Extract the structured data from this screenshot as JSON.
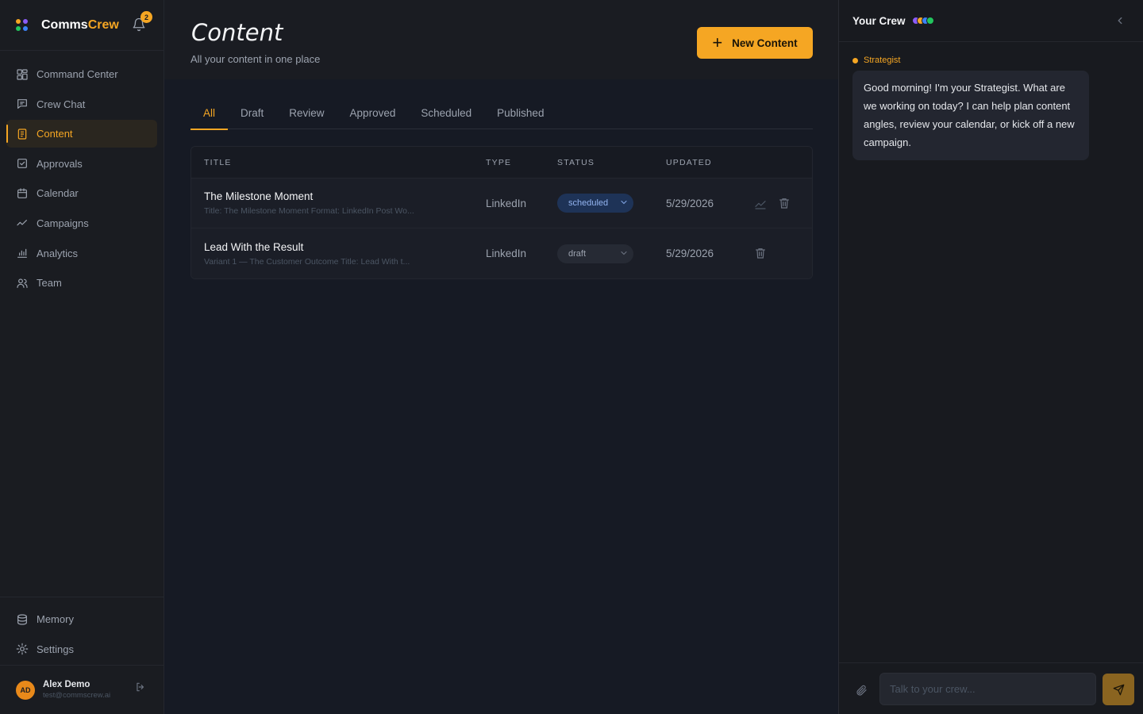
{
  "brand": {
    "name_a": "Comms",
    "name_b": "Crew",
    "notification_count": "2",
    "logo_colors": [
      "#f5a623",
      "#8b5cf6",
      "#22c55e",
      "#3b82f6"
    ]
  },
  "sidebar": {
    "items": [
      {
        "label": "Command Center",
        "icon": "grid-icon"
      },
      {
        "label": "Crew Chat",
        "icon": "chat-icon"
      },
      {
        "label": "Content",
        "icon": "document-icon",
        "active": true
      },
      {
        "label": "Approvals",
        "icon": "check-square-icon"
      },
      {
        "label": "Calendar",
        "icon": "calendar-icon"
      },
      {
        "label": "Campaigns",
        "icon": "trend-icon"
      },
      {
        "label": "Analytics",
        "icon": "bar-chart-icon"
      },
      {
        "label": "Team",
        "icon": "users-icon"
      }
    ],
    "bottom": [
      {
        "label": "Memory",
        "icon": "database-icon"
      },
      {
        "label": "Settings",
        "icon": "gear-icon"
      }
    ],
    "user": {
      "initials": "AD",
      "name": "Alex Demo",
      "email": "test@commscrew.ai"
    }
  },
  "main": {
    "title": "Content",
    "subtitle": "All your content in one place",
    "new_button": "New Content",
    "tabs": [
      "All",
      "Draft",
      "Review",
      "Approved",
      "Scheduled",
      "Published"
    ],
    "active_tab": "All",
    "table": {
      "headers": {
        "title": "TITLE",
        "type": "TYPE",
        "status": "STATUS",
        "updated": "UPDATED"
      },
      "rows": [
        {
          "title": "The Milestone Moment",
          "excerpt": "Title: The Milestone Moment Format: LinkedIn Post Wo...",
          "type": "LinkedIn",
          "status": "scheduled",
          "updated": "5/29/2026"
        },
        {
          "title": "Lead With the Result",
          "excerpt": "Variant 1 — The Customer Outcome Title: Lead With t...",
          "type": "LinkedIn",
          "status": "draft",
          "updated": "5/29/2026"
        }
      ]
    }
  },
  "panel": {
    "title": "Your Crew",
    "crew_colors": [
      "#8b5cf6",
      "#f5a623",
      "#3b82f6",
      "#22c55e"
    ],
    "agent": "Strategist",
    "message": "Good morning! I'm your Strategist. What are we working on today? I can help plan content angles, review your calendar, or kick off a new campaign.",
    "input_placeholder": "Talk to your crew..."
  },
  "colors": {
    "accent": "#f5a623",
    "background": "#161a24",
    "sidebar": "#1a1c21"
  }
}
